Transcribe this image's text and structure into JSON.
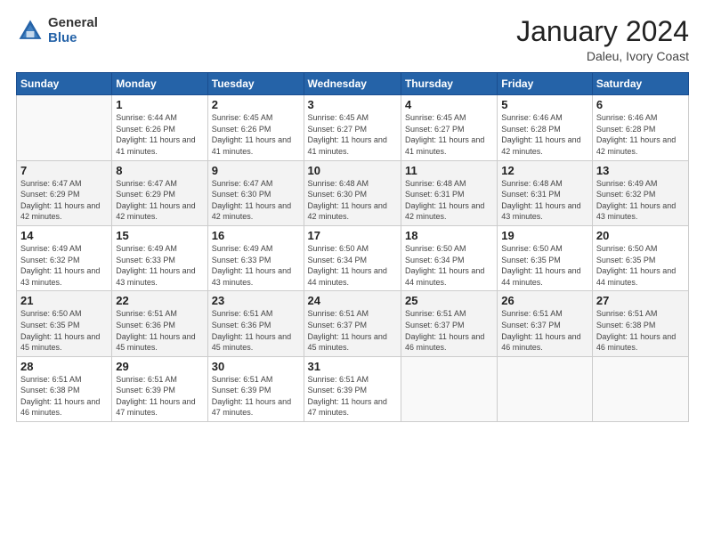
{
  "header": {
    "logo_general": "General",
    "logo_blue": "Blue",
    "month_title": "January 2024",
    "location": "Daleu, Ivory Coast"
  },
  "weekdays": [
    "Sunday",
    "Monday",
    "Tuesday",
    "Wednesday",
    "Thursday",
    "Friday",
    "Saturday"
  ],
  "weeks": [
    [
      {
        "day": "",
        "sunrise": "",
        "sunset": "",
        "daylight": "",
        "empty": true
      },
      {
        "day": "1",
        "sunrise": "Sunrise: 6:44 AM",
        "sunset": "Sunset: 6:26 PM",
        "daylight": "Daylight: 11 hours and 41 minutes."
      },
      {
        "day": "2",
        "sunrise": "Sunrise: 6:45 AM",
        "sunset": "Sunset: 6:26 PM",
        "daylight": "Daylight: 11 hours and 41 minutes."
      },
      {
        "day": "3",
        "sunrise": "Sunrise: 6:45 AM",
        "sunset": "Sunset: 6:27 PM",
        "daylight": "Daylight: 11 hours and 41 minutes."
      },
      {
        "day": "4",
        "sunrise": "Sunrise: 6:45 AM",
        "sunset": "Sunset: 6:27 PM",
        "daylight": "Daylight: 11 hours and 41 minutes."
      },
      {
        "day": "5",
        "sunrise": "Sunrise: 6:46 AM",
        "sunset": "Sunset: 6:28 PM",
        "daylight": "Daylight: 11 hours and 42 minutes."
      },
      {
        "day": "6",
        "sunrise": "Sunrise: 6:46 AM",
        "sunset": "Sunset: 6:28 PM",
        "daylight": "Daylight: 11 hours and 42 minutes."
      }
    ],
    [
      {
        "day": "7",
        "sunrise": "Sunrise: 6:47 AM",
        "sunset": "Sunset: 6:29 PM",
        "daylight": "Daylight: 11 hours and 42 minutes."
      },
      {
        "day": "8",
        "sunrise": "Sunrise: 6:47 AM",
        "sunset": "Sunset: 6:29 PM",
        "daylight": "Daylight: 11 hours and 42 minutes."
      },
      {
        "day": "9",
        "sunrise": "Sunrise: 6:47 AM",
        "sunset": "Sunset: 6:30 PM",
        "daylight": "Daylight: 11 hours and 42 minutes."
      },
      {
        "day": "10",
        "sunrise": "Sunrise: 6:48 AM",
        "sunset": "Sunset: 6:30 PM",
        "daylight": "Daylight: 11 hours and 42 minutes."
      },
      {
        "day": "11",
        "sunrise": "Sunrise: 6:48 AM",
        "sunset": "Sunset: 6:31 PM",
        "daylight": "Daylight: 11 hours and 42 minutes."
      },
      {
        "day": "12",
        "sunrise": "Sunrise: 6:48 AM",
        "sunset": "Sunset: 6:31 PM",
        "daylight": "Daylight: 11 hours and 43 minutes."
      },
      {
        "day": "13",
        "sunrise": "Sunrise: 6:49 AM",
        "sunset": "Sunset: 6:32 PM",
        "daylight": "Daylight: 11 hours and 43 minutes."
      }
    ],
    [
      {
        "day": "14",
        "sunrise": "Sunrise: 6:49 AM",
        "sunset": "Sunset: 6:32 PM",
        "daylight": "Daylight: 11 hours and 43 minutes."
      },
      {
        "day": "15",
        "sunrise": "Sunrise: 6:49 AM",
        "sunset": "Sunset: 6:33 PM",
        "daylight": "Daylight: 11 hours and 43 minutes."
      },
      {
        "day": "16",
        "sunrise": "Sunrise: 6:49 AM",
        "sunset": "Sunset: 6:33 PM",
        "daylight": "Daylight: 11 hours and 43 minutes."
      },
      {
        "day": "17",
        "sunrise": "Sunrise: 6:50 AM",
        "sunset": "Sunset: 6:34 PM",
        "daylight": "Daylight: 11 hours and 44 minutes."
      },
      {
        "day": "18",
        "sunrise": "Sunrise: 6:50 AM",
        "sunset": "Sunset: 6:34 PM",
        "daylight": "Daylight: 11 hours and 44 minutes."
      },
      {
        "day": "19",
        "sunrise": "Sunrise: 6:50 AM",
        "sunset": "Sunset: 6:35 PM",
        "daylight": "Daylight: 11 hours and 44 minutes."
      },
      {
        "day": "20",
        "sunrise": "Sunrise: 6:50 AM",
        "sunset": "Sunset: 6:35 PM",
        "daylight": "Daylight: 11 hours and 44 minutes."
      }
    ],
    [
      {
        "day": "21",
        "sunrise": "Sunrise: 6:50 AM",
        "sunset": "Sunset: 6:35 PM",
        "daylight": "Daylight: 11 hours and 45 minutes."
      },
      {
        "day": "22",
        "sunrise": "Sunrise: 6:51 AM",
        "sunset": "Sunset: 6:36 PM",
        "daylight": "Daylight: 11 hours and 45 minutes."
      },
      {
        "day": "23",
        "sunrise": "Sunrise: 6:51 AM",
        "sunset": "Sunset: 6:36 PM",
        "daylight": "Daylight: 11 hours and 45 minutes."
      },
      {
        "day": "24",
        "sunrise": "Sunrise: 6:51 AM",
        "sunset": "Sunset: 6:37 PM",
        "daylight": "Daylight: 11 hours and 45 minutes."
      },
      {
        "day": "25",
        "sunrise": "Sunrise: 6:51 AM",
        "sunset": "Sunset: 6:37 PM",
        "daylight": "Daylight: 11 hours and 46 minutes."
      },
      {
        "day": "26",
        "sunrise": "Sunrise: 6:51 AM",
        "sunset": "Sunset: 6:37 PM",
        "daylight": "Daylight: 11 hours and 46 minutes."
      },
      {
        "day": "27",
        "sunrise": "Sunrise: 6:51 AM",
        "sunset": "Sunset: 6:38 PM",
        "daylight": "Daylight: 11 hours and 46 minutes."
      }
    ],
    [
      {
        "day": "28",
        "sunrise": "Sunrise: 6:51 AM",
        "sunset": "Sunset: 6:38 PM",
        "daylight": "Daylight: 11 hours and 46 minutes."
      },
      {
        "day": "29",
        "sunrise": "Sunrise: 6:51 AM",
        "sunset": "Sunset: 6:39 PM",
        "daylight": "Daylight: 11 hours and 47 minutes."
      },
      {
        "day": "30",
        "sunrise": "Sunrise: 6:51 AM",
        "sunset": "Sunset: 6:39 PM",
        "daylight": "Daylight: 11 hours and 47 minutes."
      },
      {
        "day": "31",
        "sunrise": "Sunrise: 6:51 AM",
        "sunset": "Sunset: 6:39 PM",
        "daylight": "Daylight: 11 hours and 47 minutes."
      },
      {
        "day": "",
        "sunrise": "",
        "sunset": "",
        "daylight": "",
        "empty": true
      },
      {
        "day": "",
        "sunrise": "",
        "sunset": "",
        "daylight": "",
        "empty": true
      },
      {
        "day": "",
        "sunrise": "",
        "sunset": "",
        "daylight": "",
        "empty": true
      }
    ]
  ]
}
